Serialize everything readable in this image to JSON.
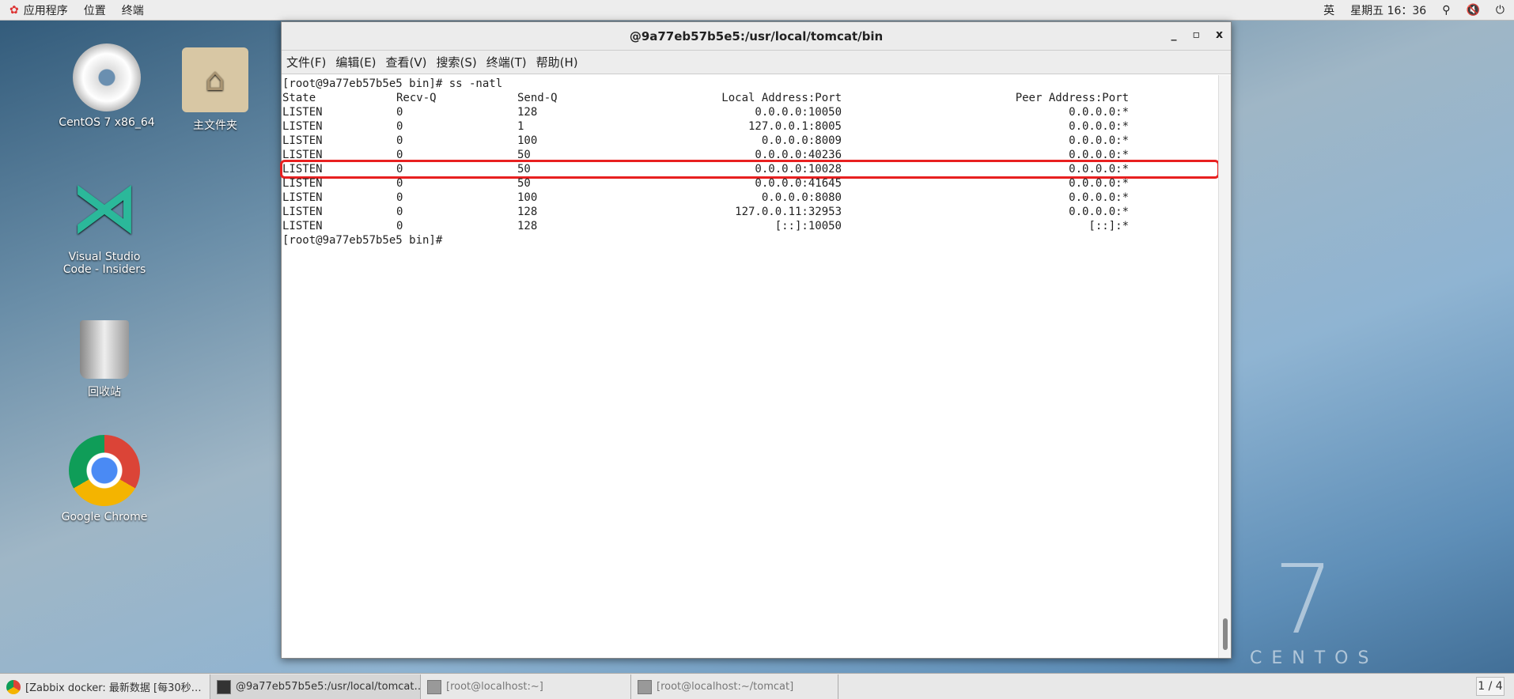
{
  "topbar": {
    "apps": "应用程序",
    "places": "位置",
    "terminal": "终端",
    "ime": "英",
    "clock": "星期五 16：36"
  },
  "desktop": [
    {
      "label": "CentOS 7 x86_64"
    },
    {
      "label": "主文件夹"
    },
    {
      "label": "Visual Studio Code - Insiders"
    },
    {
      "label": "回收站"
    },
    {
      "label": "Google Chrome"
    }
  ],
  "window": {
    "title": "@9a77eb57b5e5:/usr/local/tomcat/bin",
    "minimize": "_",
    "maximize": "▫",
    "close": "x",
    "menu": [
      "文件(F)",
      "编辑(E)",
      "查看(V)",
      "搜索(S)",
      "终端(T)",
      "帮助(H)"
    ]
  },
  "terminal": {
    "prompt1": "[root@9a77eb57b5e5 bin]# ss -natl",
    "headers": [
      "State",
      "Recv-Q",
      "Send-Q",
      "Local Address:Port",
      "Peer Address:Port"
    ],
    "rows": [
      [
        "LISTEN",
        "0",
        "128",
        "0.0.0.0:10050",
        "0.0.0.0:*"
      ],
      [
        "LISTEN",
        "0",
        "1",
        "127.0.0.1:8005",
        "0.0.0.0:*"
      ],
      [
        "LISTEN",
        "0",
        "100",
        "0.0.0.0:8009",
        "0.0.0.0:*"
      ],
      [
        "LISTEN",
        "0",
        "50",
        "0.0.0.0:40236",
        "0.0.0.0:*"
      ],
      [
        "LISTEN",
        "0",
        "50",
        "0.0.0.0:10028",
        "0.0.0.0:*"
      ],
      [
        "LISTEN",
        "0",
        "50",
        "0.0.0.0:41645",
        "0.0.0.0:*"
      ],
      [
        "LISTEN",
        "0",
        "100",
        "0.0.0.0:8080",
        "0.0.0.0:*"
      ],
      [
        "LISTEN",
        "0",
        "128",
        "127.0.0.11:32953",
        "0.0.0.0:*"
      ],
      [
        "LISTEN",
        "0",
        "128",
        "[::]:10050",
        "[::]:*"
      ]
    ],
    "highlighted_row": 4,
    "prompt2": "[root@9a77eb57b5e5 bin]#"
  },
  "taskbar": {
    "tasks": [
      "[Zabbix docker: 最新数据 [每30秒…",
      "@9a77eb57b5e5:/usr/local/tomcat…",
      "[root@localhost:~]",
      "[root@localhost:~/tomcat]"
    ],
    "pager": "1 / 4"
  },
  "branding": {
    "number": "7",
    "name": "CENTOS"
  }
}
